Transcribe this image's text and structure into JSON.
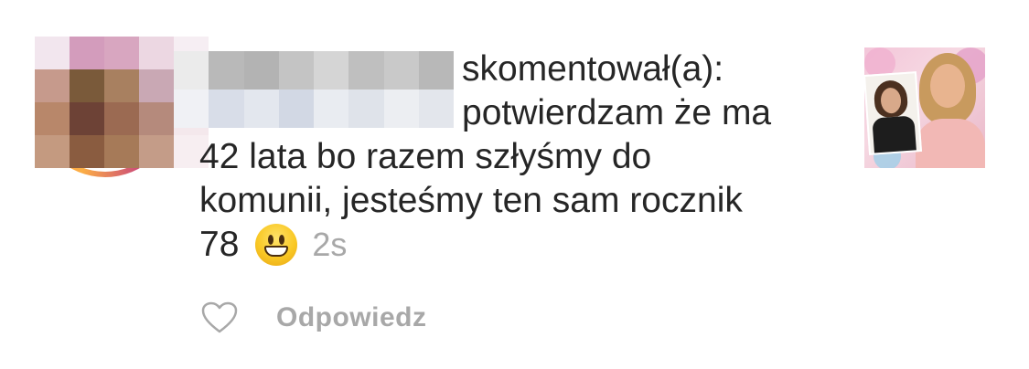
{
  "comment": {
    "action_text": "skomentował(a):",
    "line_2": "potwierdzam że ma",
    "line_3": "42 lata bo razem szłyśmy do",
    "line_4": "komunii, jesteśmy ten sam rocznik",
    "line_5": "78",
    "emoji": "grinning-face-emoji",
    "timestamp": "2s"
  },
  "actions": {
    "like_icon": "heart-outline-icon",
    "reply_label": "Odpowiedz"
  },
  "colors": {
    "text": "#262626",
    "muted": "#a8a8a8",
    "story_ring_start": "#fcaf45",
    "story_ring_end": "#c13584"
  }
}
